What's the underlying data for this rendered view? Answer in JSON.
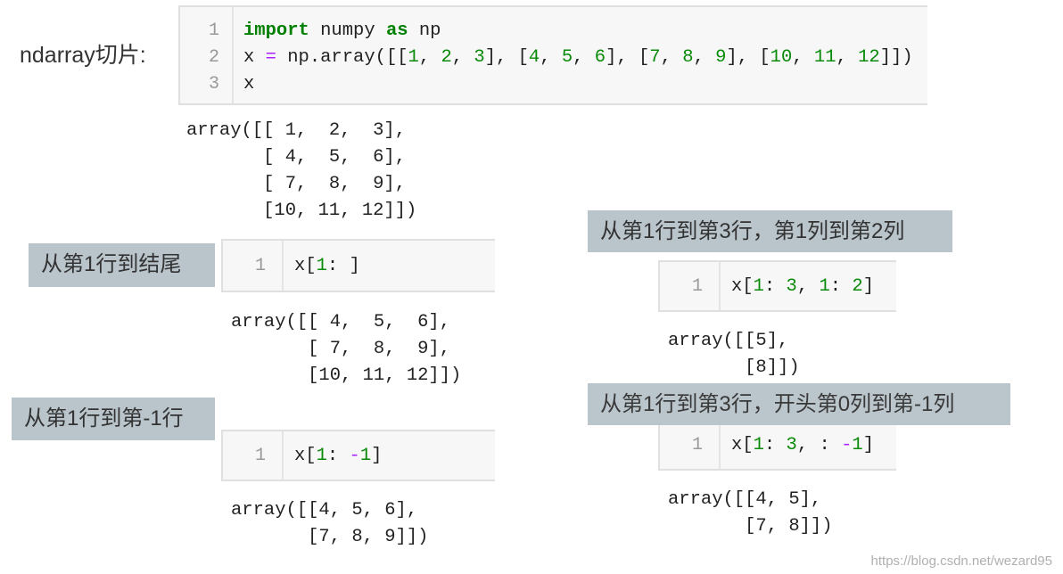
{
  "title": "ndarray切片:",
  "cells": [
    {
      "lines": [
        "1",
        "2",
        "3"
      ],
      "code": [
        [
          {
            "t": "import",
            "c": "kw"
          },
          {
            "t": " numpy "
          },
          {
            "t": "as",
            "c": "kw"
          },
          {
            "t": " np"
          }
        ],
        [
          {
            "t": "x "
          },
          {
            "t": "=",
            "c": "op"
          },
          {
            "t": " np.array([["
          },
          {
            "t": "1",
            "c": "num"
          },
          {
            "t": ", "
          },
          {
            "t": "2",
            "c": "num"
          },
          {
            "t": ", "
          },
          {
            "t": "3",
            "c": "num"
          },
          {
            "t": "], ["
          },
          {
            "t": "4",
            "c": "num"
          },
          {
            "t": ", "
          },
          {
            "t": "5",
            "c": "num"
          },
          {
            "t": ", "
          },
          {
            "t": "6",
            "c": "num"
          },
          {
            "t": "], ["
          },
          {
            "t": "7",
            "c": "num"
          },
          {
            "t": ", "
          },
          {
            "t": "8",
            "c": "num"
          },
          {
            "t": ", "
          },
          {
            "t": "9",
            "c": "num"
          },
          {
            "t": "], ["
          },
          {
            "t": "10",
            "c": "num"
          },
          {
            "t": ", "
          },
          {
            "t": "11",
            "c": "num"
          },
          {
            "t": ", "
          },
          {
            "t": "12",
            "c": "num"
          },
          {
            "t": "]])"
          }
        ],
        [
          {
            "t": "x"
          }
        ]
      ],
      "output": "array([[ 1,  2,  3],\n       [ 4,  5,  6],\n       [ 7,  8,  9],\n       [10, 11, 12]])"
    },
    {
      "label": "从第1行到结尾",
      "lines": [
        "1"
      ],
      "code": [
        [
          {
            "t": "x["
          },
          {
            "t": "1",
            "c": "num"
          },
          {
            "t": ": ]"
          }
        ]
      ],
      "output": "array([[ 4,  5,  6],\n       [ 7,  8,  9],\n       [10, 11, 12]])"
    },
    {
      "label": "从第1行到第-1行",
      "lines": [
        "1"
      ],
      "code": [
        [
          {
            "t": "x["
          },
          {
            "t": "1",
            "c": "num"
          },
          {
            "t": ": "
          },
          {
            "t": "-",
            "c": "op"
          },
          {
            "t": "1",
            "c": "num"
          },
          {
            "t": "]"
          }
        ]
      ],
      "output": "array([[4, 5, 6],\n       [7, 8, 9]])"
    },
    {
      "label": "从第1行到第3行，第1列到第2列",
      "lines": [
        "1"
      ],
      "code": [
        [
          {
            "t": "x["
          },
          {
            "t": "1",
            "c": "num"
          },
          {
            "t": ": "
          },
          {
            "t": "3",
            "c": "num"
          },
          {
            "t": ", "
          },
          {
            "t": "1",
            "c": "num"
          },
          {
            "t": ": "
          },
          {
            "t": "2",
            "c": "num"
          },
          {
            "t": "]"
          }
        ]
      ],
      "output": "array([[5],\n       [8]])"
    },
    {
      "label": "从第1行到第3行，开头第0列到第-1列",
      "lines": [
        "1"
      ],
      "code": [
        [
          {
            "t": "x["
          },
          {
            "t": "1",
            "c": "num"
          },
          {
            "t": ": "
          },
          {
            "t": "3",
            "c": "num"
          },
          {
            "t": ", : "
          },
          {
            "t": "-",
            "c": "op"
          },
          {
            "t": "1",
            "c": "num"
          },
          {
            "t": "]"
          }
        ]
      ],
      "output": "array([[4, 5],\n       [7, 8]])"
    }
  ],
  "watermark": "https://blog.csdn.net/wezard95",
  "colors": {
    "keyword": "#008000",
    "number": "#098a09",
    "operator": "#aa22ff",
    "label_bg": "#b9c4cb"
  }
}
